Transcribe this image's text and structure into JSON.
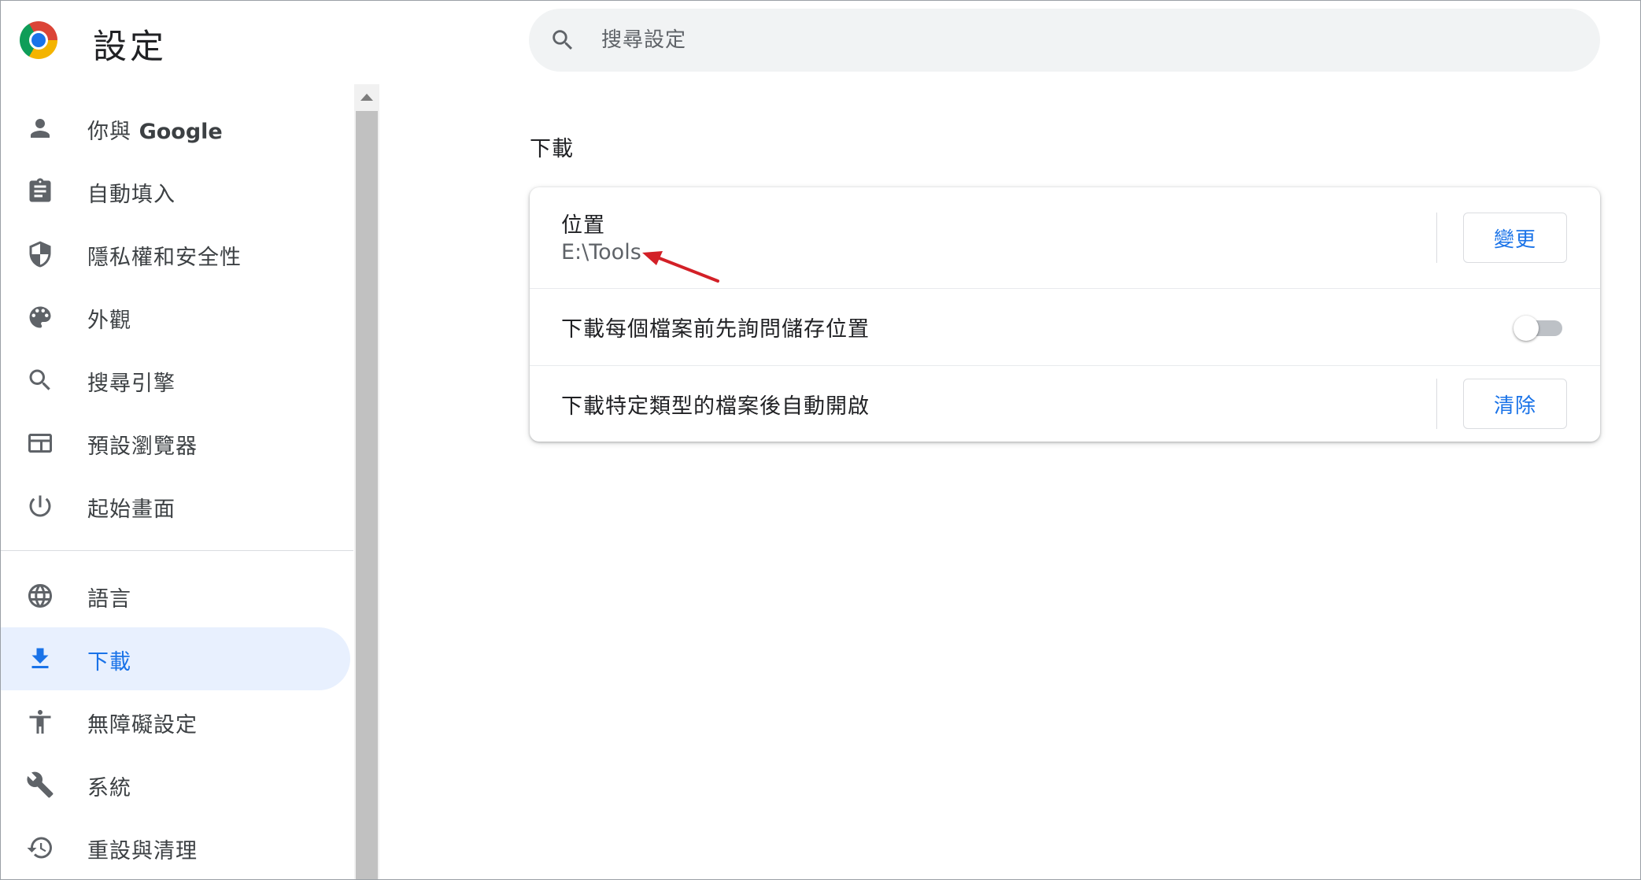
{
  "header": {
    "title": "設定",
    "search_placeholder": "搜尋設定"
  },
  "sidebar": {
    "items": [
      {
        "label": "你與 ",
        "label_bold": "Google",
        "icon": "person-icon",
        "active": false
      },
      {
        "label": "自動填入",
        "icon": "clipboard-icon",
        "active": false
      },
      {
        "label": "隱私權和安全性",
        "icon": "shield-icon",
        "active": false
      },
      {
        "label": "外觀",
        "icon": "palette-icon",
        "active": false
      },
      {
        "label": "搜尋引擎",
        "icon": "search-icon",
        "active": false
      },
      {
        "label": "預設瀏覽器",
        "icon": "browser-window-icon",
        "active": false
      },
      {
        "label": "起始畫面",
        "icon": "power-icon",
        "active": false
      },
      {
        "label": "語言",
        "icon": "globe-icon",
        "active": false
      },
      {
        "label": "下載",
        "icon": "download-icon",
        "active": true
      },
      {
        "label": "無障礙設定",
        "icon": "accessibility-icon",
        "active": false
      },
      {
        "label": "系統",
        "icon": "wrench-icon",
        "active": false
      },
      {
        "label": "重設與清理",
        "icon": "history-icon",
        "active": false
      }
    ]
  },
  "main": {
    "section_title": "下載",
    "location": {
      "label": "位置",
      "value": "E:\\Tools",
      "button": "變更"
    },
    "ask_each": {
      "label": "下載每個檔案前先詢問儲存位置",
      "enabled": false
    },
    "auto_open": {
      "label": "下載特定類型的檔案後自動開啟",
      "button": "清除"
    }
  },
  "colors": {
    "accent": "#1a73e8",
    "active_bg": "#e8f0fe",
    "annotation": "#d32027"
  }
}
